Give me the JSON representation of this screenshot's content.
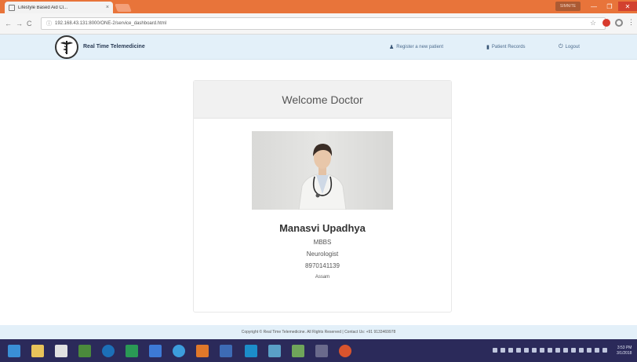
{
  "browser": {
    "tab_title": "Lifestyle Based Aid Cl...",
    "tab_close": "×",
    "url": "192.168.43.131:8000/ONE-2/service_dashboard.html",
    "user_chip": "SIMNITE",
    "window_min": "—",
    "window_max": "❐",
    "window_close": "✕",
    "back": "←",
    "forward": "→",
    "reload": "C",
    "info": "ⓘ",
    "star": "☆",
    "menu": "⋮"
  },
  "navbar": {
    "brand": "Real Time Telemedicine",
    "links": [
      {
        "label": "Register a new patient",
        "icon": "user-icon"
      },
      {
        "label": "Patient Records",
        "icon": "file-icon"
      },
      {
        "label": "Logout",
        "icon": "power-icon"
      }
    ]
  },
  "card": {
    "header": "Welcome Doctor",
    "name": "Manasvi Upadhya",
    "degree": "MBBS",
    "speciality": "Neurologist",
    "phone": "8970141139",
    "extra": "Assam"
  },
  "footer": {
    "text": "Copyright © Real Time Telemedicine. All Rights Reserved | Contact Us: +91 9133469978"
  },
  "taskbar": {
    "clock_time": "3:53 PM",
    "clock_date": "3/1/2018"
  },
  "colors": {
    "tabbar": "#e8743a",
    "navbar": "#e3f0f9",
    "taskbar": "#2b2a5a"
  }
}
